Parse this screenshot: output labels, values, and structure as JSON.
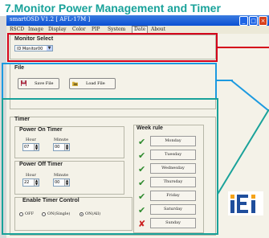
{
  "heading": "7.Monitor Power Management and Timer",
  "window": {
    "title": "smartOSD V1.2 [ AFL-17M ]",
    "menu": [
      "RSCD",
      "Image",
      "Display",
      "Color",
      "PIP",
      "System",
      "Date",
      "About"
    ],
    "active_menu": "Date"
  },
  "monitor_select": {
    "label": "Monitor Select",
    "value": "ID Monitor00"
  },
  "file": {
    "label": "File",
    "save_label": "Save File",
    "load_label": "Load File"
  },
  "timer": {
    "label": "Timer",
    "power_on": {
      "label": "Power On Timer",
      "hour_label": "Hour",
      "minute_label": "Minute",
      "hour": "07",
      "minute": "00"
    },
    "power_off": {
      "label": "Power Off Timer",
      "hour_label": "Hour",
      "minute_label": "Minute",
      "hour": "22",
      "minute": "00"
    },
    "control": {
      "label": "Enable Timer Control",
      "options": [
        "OFF",
        "ON(Single)",
        "ON(All)"
      ],
      "selected": "ON(All)"
    }
  },
  "week_rule": {
    "label": "Week rule",
    "days": [
      {
        "name": "Monday",
        "enabled": true
      },
      {
        "name": "Tuesday",
        "enabled": true
      },
      {
        "name": "Wednesday",
        "enabled": true
      },
      {
        "name": "Thursday",
        "enabled": true
      },
      {
        "name": "Friday",
        "enabled": true
      },
      {
        "name": "Saturday",
        "enabled": true
      },
      {
        "name": "Sunday",
        "enabled": false
      }
    ]
  },
  "logo": "iEi",
  "colors": {
    "heading": "#19a29a",
    "red_callout": "#d4001a",
    "blue_callout": "#1c9ae0",
    "green_callout": "#19a29a",
    "logo_blue": "#1f4e9c"
  },
  "icons": {
    "titlebar_buttons": [
      "minimize-icon",
      "maximize-icon",
      "close-icon"
    ],
    "enabled_day": "check-icon",
    "disabled_day": "x-icon"
  }
}
